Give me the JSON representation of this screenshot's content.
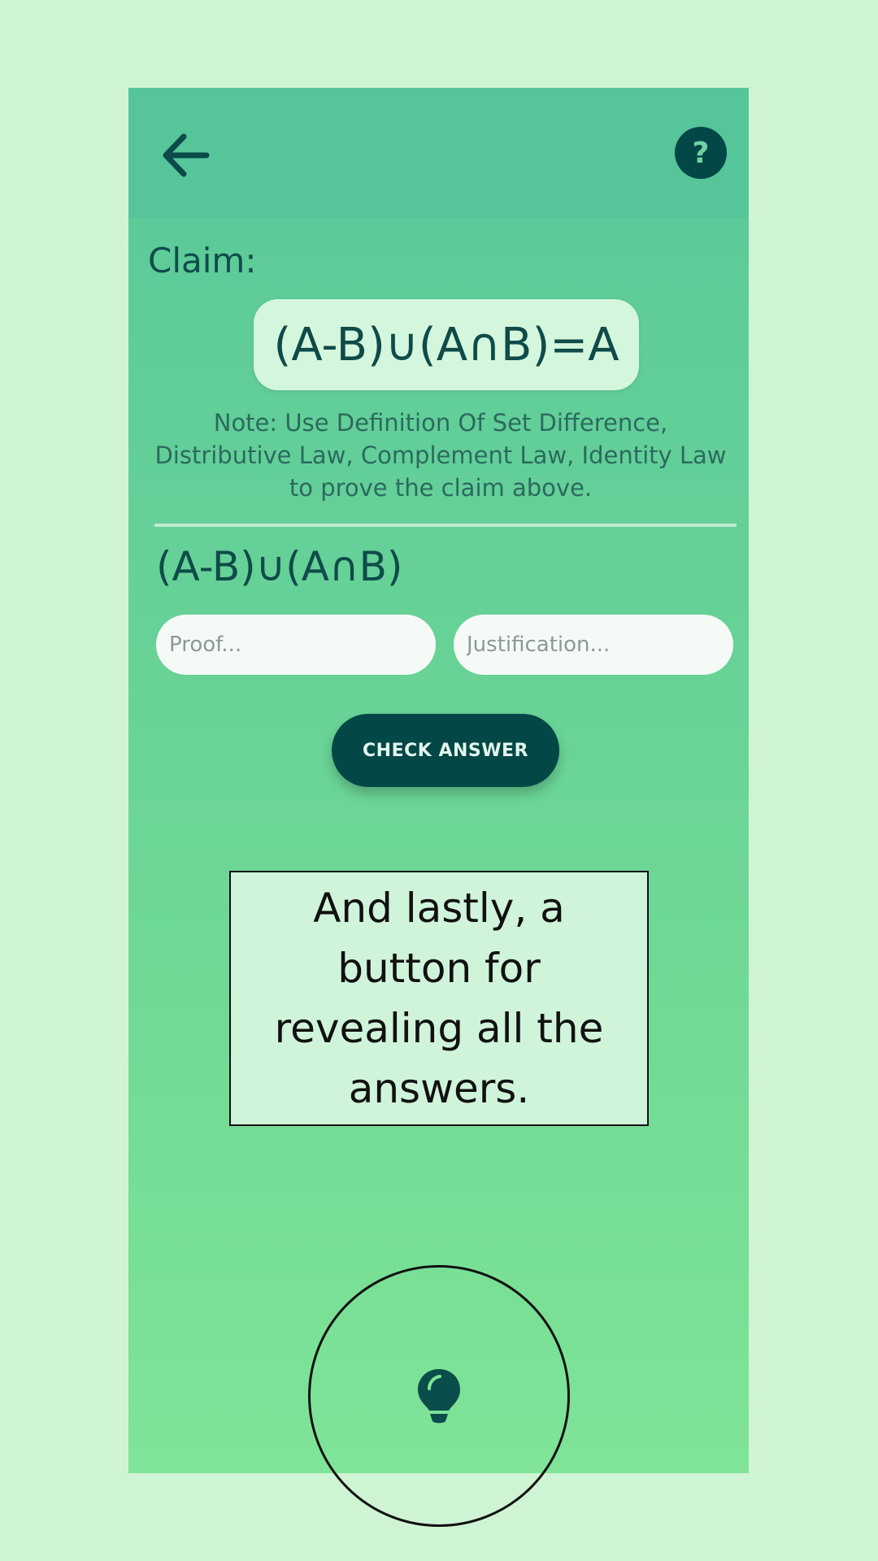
{
  "header": {
    "back_icon": "back-arrow-icon",
    "help_icon": "question-mark-icon",
    "help_glyph": "?"
  },
  "claim": {
    "label": "Claim:",
    "expression": "(A-B)∪(A∩B)=A"
  },
  "note": "Note: Use Definition Of Set Difference, Distributive Law, Complement Law, Identity Law to prove the claim above.",
  "step": {
    "expression": "(A-B)∪(A∩B)",
    "proof_placeholder": "Proof...",
    "justification_placeholder": "Justification..."
  },
  "check_button_label": "CHECK ANSWER",
  "tooltip_text": "And lastly, a button for revealing all the answers.",
  "reveal_icon": "lightbulb-icon",
  "colors": {
    "accent_dark": "#034746",
    "background": "#cff4d4",
    "gradient_top": "#57c69b",
    "gradient_bottom": "#7fe497"
  }
}
